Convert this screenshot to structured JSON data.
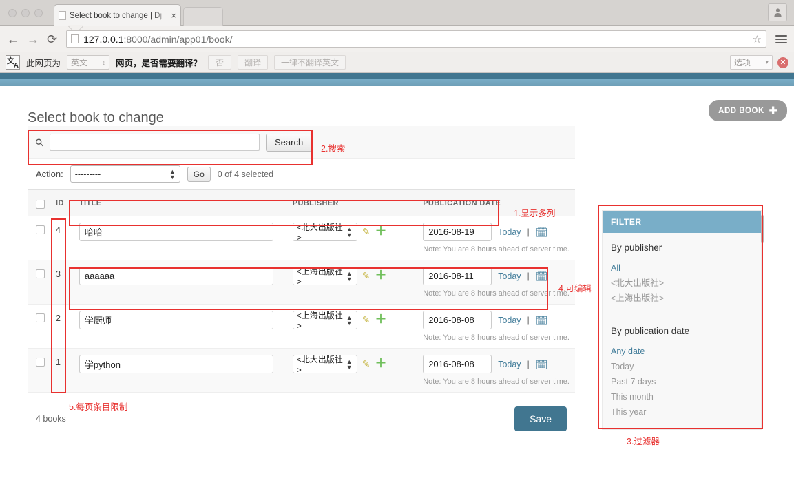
{
  "browser": {
    "tab_title": "Select book to change | Dj",
    "tab_close": "×",
    "back_icon": "←",
    "forward_icon": "→",
    "reload_icon": "⟳",
    "url_host": "127.0.0.1",
    "url_rest": ":8000/admin/app01/book/",
    "star_icon": "☆",
    "profile_icon": "👤"
  },
  "translate_bar": {
    "logo_cn": "文",
    "logo_en": "A",
    "prefix": "此网页为",
    "lang_value": "英文",
    "question": "网页，是否需要翻译？",
    "btn_no": "否",
    "btn_translate": "翻译",
    "btn_never": "一律不翻译英文",
    "options": "选项",
    "close": "✕"
  },
  "page": {
    "title": "Select book to change",
    "add_button": "ADD BOOK",
    "add_plus": "✚"
  },
  "search": {
    "icon": "⚲",
    "value": "",
    "placeholder": "",
    "button": "Search"
  },
  "actions": {
    "label": "Action:",
    "selected": "---------",
    "go": "Go",
    "counter": "0 of 4 selected"
  },
  "table": {
    "headers": [
      "ID",
      "TITLE",
      "PUBLISHER",
      "PUBLICATION DATE"
    ],
    "today_label": "Today",
    "separator": "|",
    "calendar_icon": "🗓",
    "pencil_icon": "✎",
    "plus_icon": "＋",
    "note": "Note: You are 8 hours ahead of server time.",
    "rows": [
      {
        "id": "4",
        "title": "哈哈",
        "publisher": "<北大出版社>",
        "date": "2016-08-19"
      },
      {
        "id": "3",
        "title": "aaaaaa",
        "publisher": "<上海出版社>",
        "date": "2016-08-11"
      },
      {
        "id": "2",
        "title": "学厨师",
        "publisher": "<上海出版社>",
        "date": "2016-08-08"
      },
      {
        "id": "1",
        "title": "学python",
        "publisher": "<北大出版社>",
        "date": "2016-08-08"
      }
    ]
  },
  "footer": {
    "count": "4 books",
    "save": "Save"
  },
  "filter": {
    "header": "FILTER",
    "groups": [
      {
        "title": "By publisher",
        "items": [
          {
            "label": "All",
            "selected": true
          },
          {
            "label": "<北大出版社>",
            "selected": false
          },
          {
            "label": "<上海出版社>",
            "selected": false
          }
        ]
      },
      {
        "title": "By publication date",
        "items": [
          {
            "label": "Any date",
            "selected": true
          },
          {
            "label": "Today",
            "selected": false
          },
          {
            "label": "Past 7 days",
            "selected": false
          },
          {
            "label": "This month",
            "selected": false
          },
          {
            "label": "This year",
            "selected": false
          }
        ]
      }
    ]
  },
  "annotations": {
    "color": "#e8312f",
    "labels": {
      "columns": "1.显示多列",
      "search": "2.搜索",
      "filter": "3.过滤器",
      "editable": "4.可编辑",
      "perpage": "5.每页条目限制"
    }
  }
}
